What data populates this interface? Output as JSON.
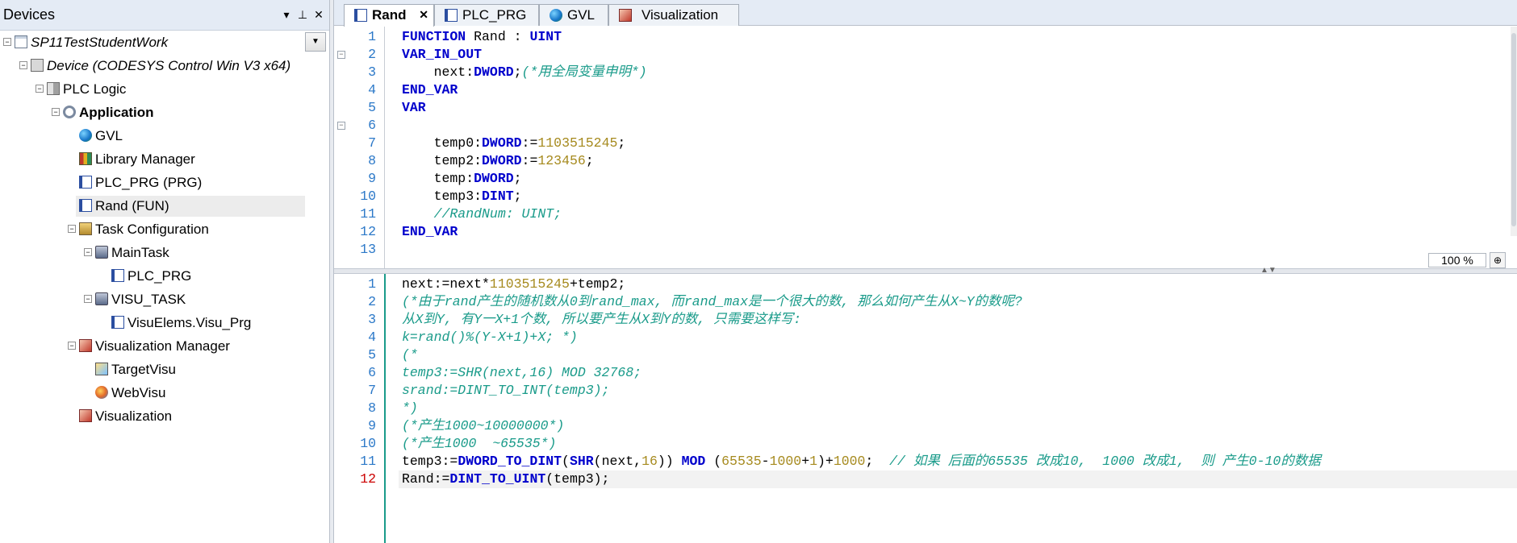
{
  "devices": {
    "title": "Devices",
    "header_buttons": [
      "▾",
      "⊥",
      "✕"
    ],
    "tree": [
      {
        "label": "SP11TestStudentWork",
        "icon": "project-icon",
        "style": "italic",
        "expander": "−"
      },
      {
        "label": "Device (CODESYS Control Win V3 x64)",
        "icon": "device-icon",
        "style": "italic",
        "expander": "−"
      },
      {
        "label": "PLC Logic",
        "icon": "plc-icon",
        "style": "normal",
        "expander": "−"
      },
      {
        "label": "Application",
        "icon": "gear-icon",
        "style": "bold",
        "expander": "−"
      },
      {
        "label": "GVL",
        "icon": "globe-icon",
        "style": "normal",
        "expander": ""
      },
      {
        "label": "Library Manager",
        "icon": "library-icon",
        "style": "normal",
        "expander": ""
      },
      {
        "label": "PLC_PRG (PRG)",
        "icon": "program-icon",
        "style": "normal",
        "expander": ""
      },
      {
        "label": "Rand (FUN)",
        "icon": "program-icon",
        "style": "normal",
        "expander": "",
        "selected": true
      },
      {
        "label": "Task Configuration",
        "icon": "task-config-icon",
        "style": "normal",
        "expander": "−"
      },
      {
        "label": "MainTask",
        "icon": "task-icon",
        "style": "normal",
        "expander": "−"
      },
      {
        "label": "PLC_PRG",
        "icon": "program-call-icon",
        "style": "normal",
        "expander": ""
      },
      {
        "label": "VISU_TASK",
        "icon": "task-icon",
        "style": "normal",
        "expander": "−"
      },
      {
        "label": "VisuElems.Visu_Prg",
        "icon": "program-call-icon",
        "style": "normal",
        "expander": ""
      },
      {
        "label": "Visualization Manager",
        "icon": "visu-manager-icon",
        "style": "normal",
        "expander": "−"
      },
      {
        "label": "TargetVisu",
        "icon": "target-visu-icon",
        "style": "normal",
        "expander": ""
      },
      {
        "label": "WebVisu",
        "icon": "web-visu-icon",
        "style": "normal",
        "expander": ""
      },
      {
        "label": "Visualization",
        "icon": "visualization-icon",
        "style": "normal",
        "expander": ""
      }
    ]
  },
  "tabs": [
    {
      "label": "Rand",
      "icon": "function-icon",
      "active": true,
      "close": "✕"
    },
    {
      "label": "PLC_PRG",
      "icon": "program-icon",
      "active": false
    },
    {
      "label": "GVL",
      "icon": "globe-icon",
      "active": false
    },
    {
      "label": "Visualization",
      "icon": "visualization-icon",
      "active": false
    }
  ],
  "declaration": {
    "lines": [
      [
        {
          "t": "FUNCTION ",
          "c": "kw"
        },
        {
          "t": "Rand : ",
          "c": "tx"
        },
        {
          "t": "UINT",
          "c": "ty"
        }
      ],
      [
        {
          "t": "VAR_IN_OUT",
          "c": "kw"
        }
      ],
      [
        {
          "t": "    next:",
          "c": "tx"
        },
        {
          "t": "DWORD",
          "c": "ty"
        },
        {
          "t": ";",
          "c": "tx"
        },
        {
          "t": "(*用全局变量申明*)",
          "c": "cm"
        }
      ],
      [
        {
          "t": "END_VAR",
          "c": "kw"
        }
      ],
      [
        {
          "t": "VAR",
          "c": "kw"
        }
      ],
      [],
      [
        {
          "t": "    temp0:",
          "c": "tx"
        },
        {
          "t": "DWORD",
          "c": "ty"
        },
        {
          "t": ":=",
          "c": "tx"
        },
        {
          "t": "1103515245",
          "c": "num"
        },
        {
          "t": ";",
          "c": "tx"
        }
      ],
      [
        {
          "t": "    temp2:",
          "c": "tx"
        },
        {
          "t": "DWORD",
          "c": "ty"
        },
        {
          "t": ":=",
          "c": "tx"
        },
        {
          "t": "123456",
          "c": "num"
        },
        {
          "t": ";",
          "c": "tx"
        }
      ],
      [
        {
          "t": "    temp:",
          "c": "tx"
        },
        {
          "t": "DWORD",
          "c": "ty"
        },
        {
          "t": ";",
          "c": "tx"
        }
      ],
      [
        {
          "t": "    temp3:",
          "c": "tx"
        },
        {
          "t": "DINT",
          "c": "ty"
        },
        {
          "t": ";",
          "c": "tx"
        }
      ],
      [
        {
          "t": "    //RandNum: UINT;",
          "c": "cm"
        }
      ],
      [
        {
          "t": "END_VAR",
          "c": "kw"
        }
      ],
      []
    ],
    "fold_lines": [
      2,
      6
    ]
  },
  "implementation": {
    "current_line": 12,
    "lines": [
      [
        {
          "t": "next:=next*",
          "c": "tx"
        },
        {
          "t": "1103515245",
          "c": "num"
        },
        {
          "t": "+temp2;",
          "c": "tx"
        }
      ],
      [
        {
          "t": "(*由于rand产生的随机数从0到rand_max, 而rand_max是一个很大的数, 那么如何产生从X~Y的数呢?",
          "c": "cm"
        }
      ],
      [
        {
          "t": "从X到Y, 有Y一X+1个数, 所以要产生从X到Y的数, 只需要这样写:",
          "c": "cm"
        }
      ],
      [
        {
          "t": "k=rand()%(Y-X+1)+X; *)",
          "c": "cm"
        }
      ],
      [
        {
          "t": "(*",
          "c": "cm"
        }
      ],
      [
        {
          "t": "temp3:=SHR(next,16) MOD 32768;",
          "c": "cm"
        }
      ],
      [
        {
          "t": "srand:=DINT_TO_INT(temp3);",
          "c": "cm"
        }
      ],
      [
        {
          "t": "*)",
          "c": "cm"
        }
      ],
      [
        {
          "t": "(*产生1000~10000000*)",
          "c": "cm"
        }
      ],
      [
        {
          "t": "(*产生1000  ~65535*)",
          "c": "cm"
        }
      ],
      [
        {
          "t": "temp3:=",
          "c": "tx"
        },
        {
          "t": "DWORD_TO_DINT",
          "c": "kw"
        },
        {
          "t": "(",
          "c": "tx"
        },
        {
          "t": "SHR",
          "c": "kw"
        },
        {
          "t": "(next,",
          "c": "tx"
        },
        {
          "t": "16",
          "c": "num"
        },
        {
          "t": ")) ",
          "c": "tx"
        },
        {
          "t": "MOD",
          "c": "kw"
        },
        {
          "t": " (",
          "c": "tx"
        },
        {
          "t": "65535",
          "c": "num"
        },
        {
          "t": "-",
          "c": "tx"
        },
        {
          "t": "1000",
          "c": "num"
        },
        {
          "t": "+",
          "c": "tx"
        },
        {
          "t": "1",
          "c": "num"
        },
        {
          "t": ")+",
          "c": "tx"
        },
        {
          "t": "1000",
          "c": "num"
        },
        {
          "t": ";  ",
          "c": "tx"
        },
        {
          "t": "// 如果 后面的65535 改成10,  1000 改成1,  则 产生0-10的数据",
          "c": "cm"
        }
      ],
      [
        {
          "t": "Rand:=",
          "c": "tx"
        },
        {
          "t": "DINT_TO_UINT",
          "c": "kw"
        },
        {
          "t": "(temp3);",
          "c": "tx"
        }
      ]
    ]
  },
  "zoom": {
    "level": "100 %",
    "icon": "magnifier-icon"
  },
  "colors": {
    "keyword": "#0000cc",
    "number": "#a68a1e",
    "comment": "#1a9b8a",
    "line_number": "#2b78c8",
    "current_line_number": "#cc0000"
  }
}
